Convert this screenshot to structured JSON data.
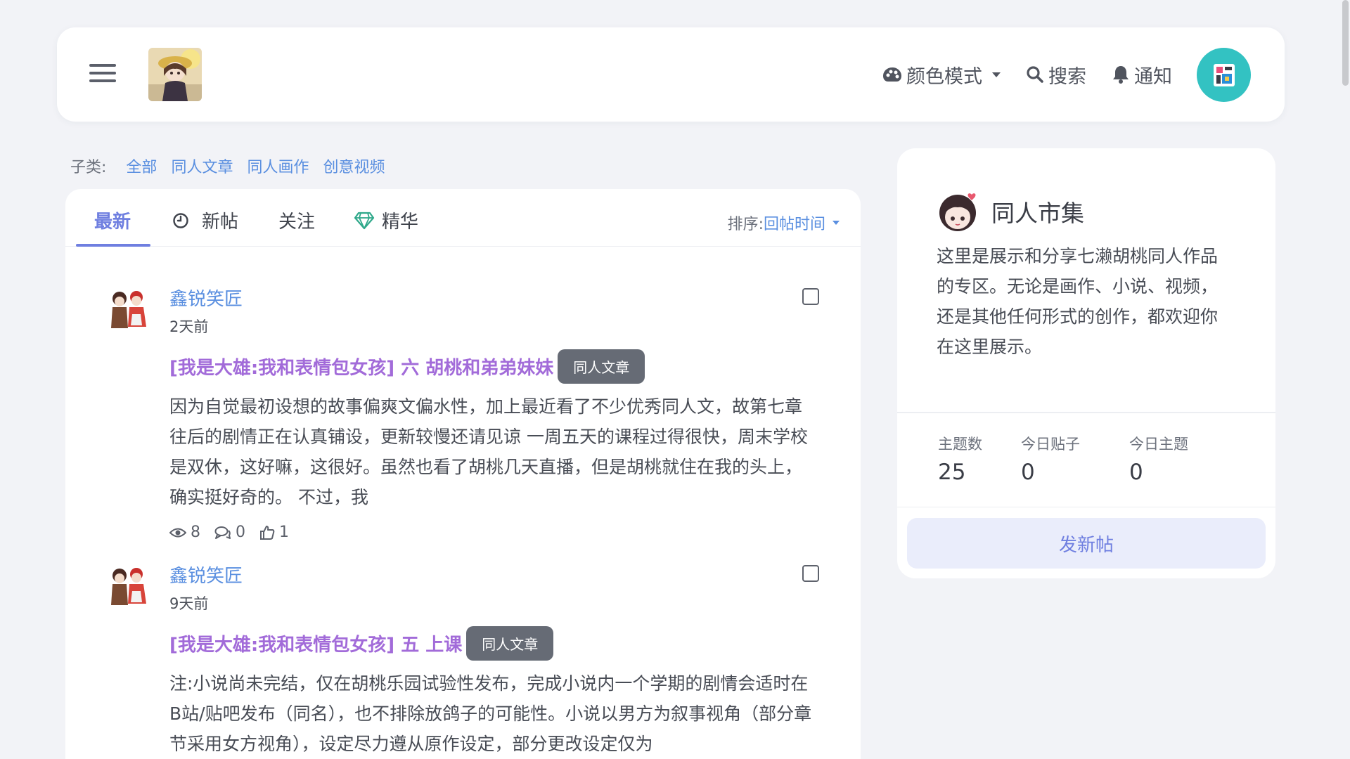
{
  "header": {
    "color_mode_label": "颜色模式",
    "search_label": "搜索",
    "notify_label": "通知"
  },
  "subcats": {
    "label": "子类:",
    "items": [
      "全部",
      "同人文章",
      "同人画作",
      "创意视频"
    ]
  },
  "tabs": {
    "latest": "最新",
    "new_posts": "新帖",
    "following": "关注",
    "featured": "精华"
  },
  "sort": {
    "label": "排序:",
    "value": "回帖时间"
  },
  "posts": [
    {
      "author": "鑫锐笑匠",
      "time": "2天前",
      "title": "[我是大雄:我和表情包女孩] 六 胡桃和弟弟妹妹",
      "tag": "同人文章",
      "excerpt": "因为自觉最初设想的故事偏爽文偏水性，加上最近看了不少优秀同人文，故第七章往后的剧情正在认真铺设，更新较慢还请见谅 一周五天的课程过得很快，周末学校是双休，这好嘛，这很好。虽然也看了胡桃几天直播，但是胡桃就住在我的头上，确实挺好奇的。 不过，我",
      "views": "8",
      "replies": "0",
      "likes": "1"
    },
    {
      "author": "鑫锐笑匠",
      "time": "9天前",
      "title": "[我是大雄:我和表情包女孩] 五 上课",
      "tag": "同人文章",
      "excerpt": "注:小说尚未完结，仅在胡桃乐园试验性发布，完成小说内一个学期的剧情会适时在B站/贴吧发布（同名），也不排除放鸽子的可能性。小说以男方为叙事视角（部分章节采用女方视角），设定尽力遵从原作设定，部分更改设定仅为"
    }
  ],
  "sidebar": {
    "title": "同人市集",
    "description": "这里是展示和分享七濑胡桃同人作品的专区。无论是画作、小说、视频，还是其他任何形式的创作，都欢迎你在这里展示。",
    "stats": [
      {
        "label": "主题数",
        "value": "25"
      },
      {
        "label": "今日贴子",
        "value": "0"
      },
      {
        "label": "今日主题",
        "value": "0"
      }
    ],
    "new_post_label": "发新帖"
  },
  "colors": {
    "accent": "#6f7fe0",
    "link": "#5a8fe0",
    "title_purple": "#a26bd9",
    "avatar_teal": "#33c2c2",
    "tag_gray": "#666b75"
  }
}
